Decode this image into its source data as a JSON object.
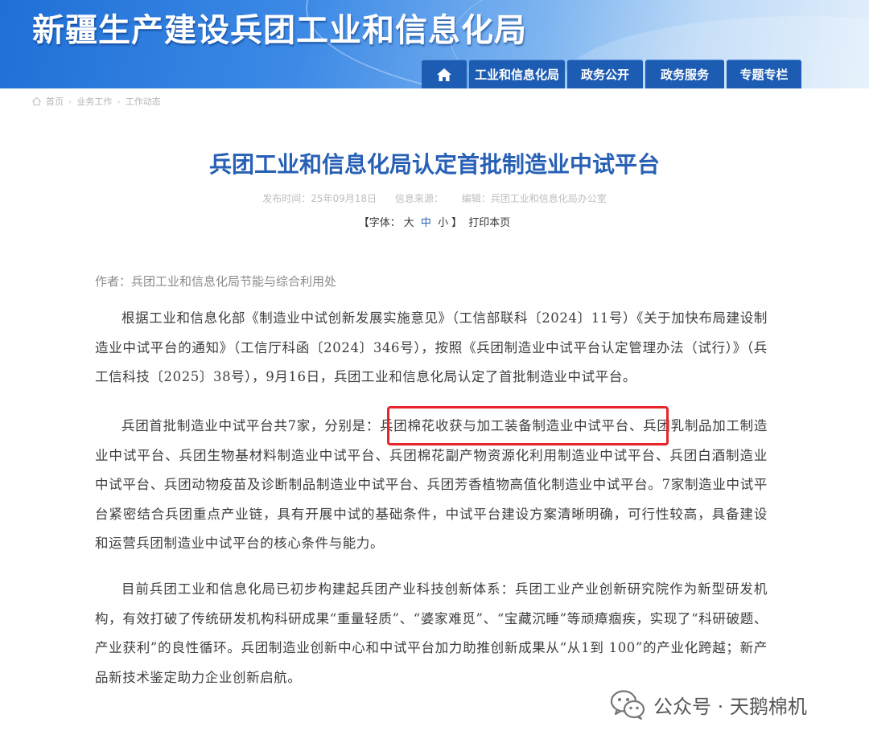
{
  "site": {
    "title": "新疆生产建设兵团工业和信息化局"
  },
  "nav": {
    "home_icon": "home-icon",
    "items": [
      "工业和信息化局",
      "政务公开",
      "政务服务",
      "专题专栏"
    ]
  },
  "breadcrumb": {
    "items": [
      "首页",
      "业务工作",
      "工作动态"
    ]
  },
  "article": {
    "title": "兵团工业和信息化局认定首批制造业中试平台",
    "meta": "发布时间：25年09月18日      信息来源：      编辑：兵团工业和信息化局办公室",
    "fontsize": {
      "open": "【字体：",
      "large": "大",
      "medium": "中",
      "small": "小",
      "close": "】",
      "print": "打印本页"
    },
    "author": "作者：兵团工业和信息化局节能与综合利用处",
    "paragraphs": [
      "根据工业和信息化部《制造业中试创新发展实施意见》（工信部联科〔2024〕11号）《关于加快布局建设制造业中试平台的通知》（工信厅科函〔2024〕346号），按照《兵团制造业中试平台认定管理办法（试行）》（兵工信科技〔2025〕38号），9月16日，兵团工业和信息化局认定了首批制造业中试平台。",
      "兵团首批制造业中试平台共7家，分别是：兵团棉花收获与加工装备制造业中试平台、兵团乳制品加工制造业中试平台、兵团生物基材料制造业中试平台、兵团棉花副产物资源化利用制造业中试平台、兵团白酒制造业中试平台、兵团动物疫苗及诊断制品制造业中试平台、兵团芳香植物高值化制造业中试平台。7家制造业中试平台紧密结合兵团重点产业链，具有开展中试的基础条件，中试平台建设方案清晰明确，可行性较高，具备建设和运营兵团制造业中试平台的核心条件与能力。",
      "目前兵团工业和信息化局已初步构建起兵团产业科技创新体系：兵团工业产业创新研究院作为新型研发机构，有效打破了传统研发机构科研成果“重量轻质”、“婆家难觅”、“宝藏沉睡”等顽瘴痼疾，实现了“科研破题、产业获利”的良性循环。兵团制造业创新中心和中试平台加力助推创新成果从“从1到 100”的产业化跨越；新产品新技术鉴定助力企业创新启航。"
    ]
  },
  "watermark": {
    "icon": "wechat-icon",
    "text": "公众号 · 天鹅棉机"
  },
  "colors": {
    "nav_bg": "#1d5cb3",
    "title": "#2760b4",
    "highlight": "#e8252c"
  }
}
